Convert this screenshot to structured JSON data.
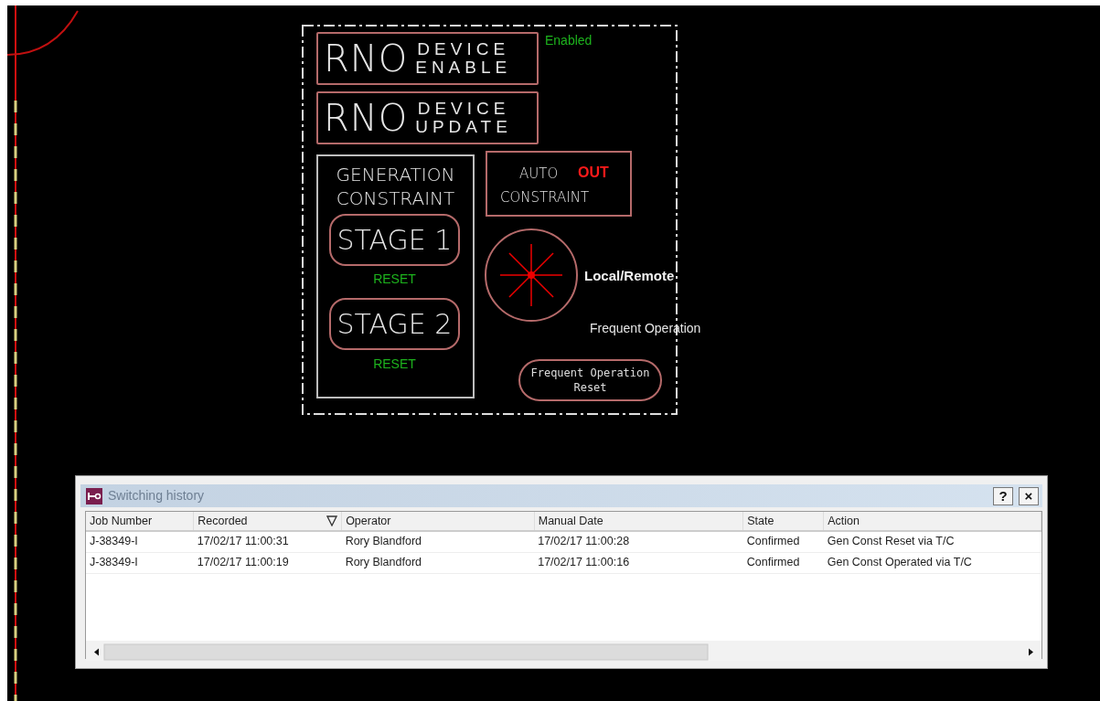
{
  "diagram": {
    "enable_status": "Enabled",
    "device_buttons": [
      {
        "prefix": "RNO",
        "line1": "DEVICE",
        "line2": "ENABLE"
      },
      {
        "prefix": "RNO",
        "line1": "DEVICE",
        "line2": "UPDATE"
      }
    ],
    "generation_constraint": {
      "title_lines": [
        "GENERATION",
        "CONSTRAINT"
      ],
      "stages": [
        {
          "label": "STAGE 1",
          "status": "RESET"
        },
        {
          "label": "STAGE 2",
          "status": "RESET"
        }
      ]
    },
    "auto_constraint": {
      "label_lines": [
        "AUTO",
        "CONSTRAINT"
      ],
      "status": "OUT"
    },
    "local_remote": {
      "label": "Local/Remote"
    },
    "frequent_operation": {
      "label": "Frequent Operation",
      "reset_lines": [
        "Frequent Operation",
        "Reset"
      ]
    }
  },
  "dialog": {
    "title": "Switching history",
    "help": "?",
    "close": "×",
    "columns": [
      {
        "label": "Job Number",
        "sorted": false
      },
      {
        "label": "Recorded",
        "sorted": true
      },
      {
        "label": "Operator",
        "sorted": false
      },
      {
        "label": "Manual Date",
        "sorted": false
      },
      {
        "label": "State",
        "sorted": false
      },
      {
        "label": "Action",
        "sorted": false
      }
    ],
    "rows": [
      [
        "J-38349-I",
        "17/02/17 11:00:31",
        "Rory Blandford",
        "17/02/17 11:00:28",
        "Confirmed",
        "Gen Const Reset via T/C"
      ],
      [
        "J-38349-I",
        "17/02/17 11:00:19",
        "Rory Blandford",
        "17/02/17 11:00:16",
        "Confirmed",
        "Gen Const Operated via T/C"
      ]
    ]
  }
}
